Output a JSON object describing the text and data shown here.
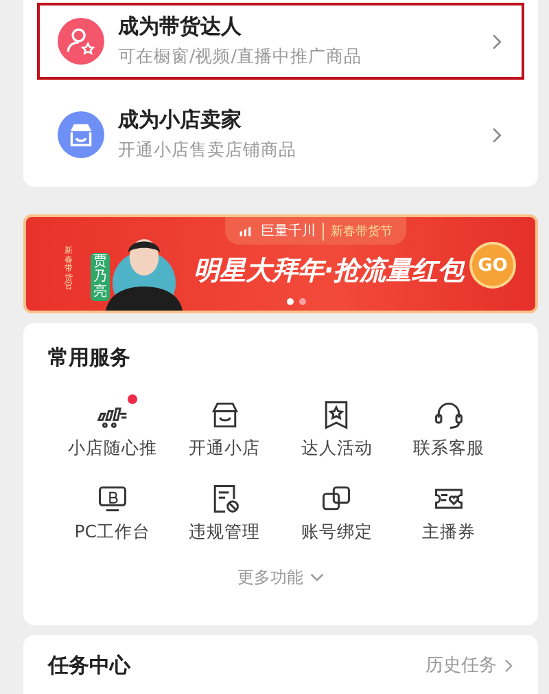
{
  "entries": [
    {
      "kind": "creator",
      "title": "成为带货达人",
      "subtitle": "可在橱窗/视频/直播中推广商品",
      "highlighted": true
    },
    {
      "kind": "seller",
      "title": "成为小店卖家",
      "subtitle": "开通小店售卖店铺商品",
      "highlighted": false
    }
  ],
  "banner": {
    "brand": "巨量千川",
    "event": "新春带货节",
    "tag": "新春带货官",
    "name": "贾乃亮",
    "headline": "明星大拜年·抢流量红包",
    "button": "GO",
    "dots": [
      {
        "selected": true
      },
      {
        "selected": false
      }
    ]
  },
  "services": {
    "title": "常用服务",
    "items": [
      {
        "kind": "promote",
        "label": "小店随心推",
        "badge": true
      },
      {
        "kind": "shop",
        "label": "开通小店",
        "badge": false
      },
      {
        "kind": "star",
        "label": "达人活动",
        "badge": false
      },
      {
        "kind": "headset",
        "label": "联系客服",
        "badge": false
      },
      {
        "kind": "monitor",
        "label": "PC工作台",
        "badge": false
      },
      {
        "kind": "violation",
        "label": "违规管理",
        "badge": false
      },
      {
        "kind": "link",
        "label": "账号绑定",
        "badge": false
      },
      {
        "kind": "coupon",
        "label": "主播券",
        "badge": false
      }
    ],
    "more": "更多功能"
  },
  "tasks": {
    "title": "任务中心",
    "history": "历史任务"
  }
}
